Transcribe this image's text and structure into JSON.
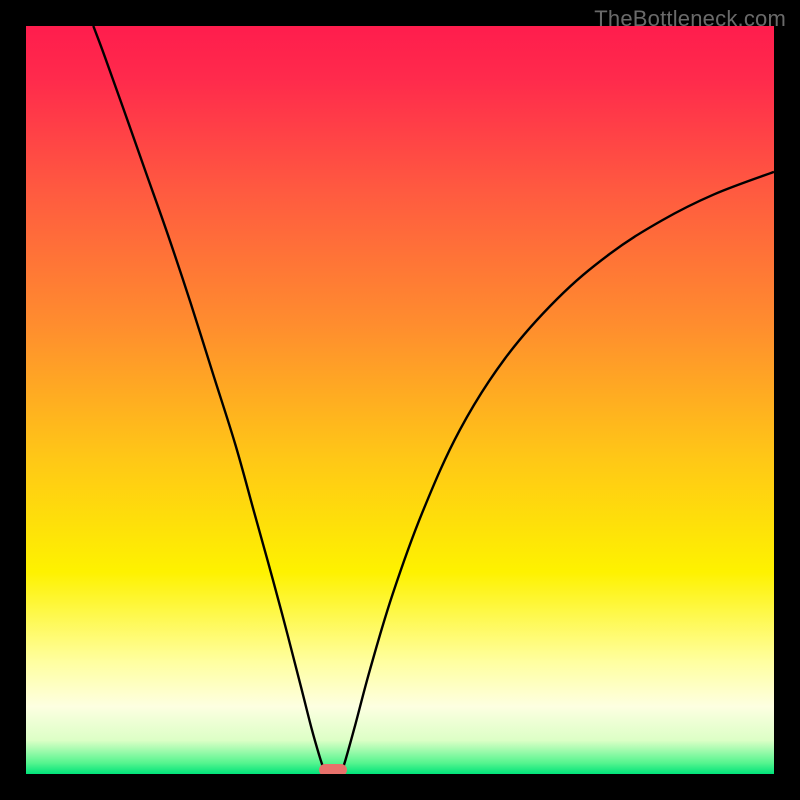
{
  "watermark": "TheBottleneck.com",
  "chart_data": {
    "type": "line",
    "title": "",
    "xlabel": "",
    "ylabel": "",
    "xlim": [
      0,
      100
    ],
    "ylim": [
      0,
      100
    ],
    "grid": false,
    "gradient_stops": [
      {
        "pos": 0.0,
        "color": "#ff1d4d"
      },
      {
        "pos": 0.07,
        "color": "#ff2a4c"
      },
      {
        "pos": 0.22,
        "color": "#ff5a40"
      },
      {
        "pos": 0.4,
        "color": "#ff8d2e"
      },
      {
        "pos": 0.58,
        "color": "#ffc816"
      },
      {
        "pos": 0.73,
        "color": "#fef200"
      },
      {
        "pos": 0.85,
        "color": "#ffffa0"
      },
      {
        "pos": 0.91,
        "color": "#fdffe1"
      },
      {
        "pos": 0.955,
        "color": "#dcffc6"
      },
      {
        "pos": 0.985,
        "color": "#57f58f"
      },
      {
        "pos": 1.0,
        "color": "#00e37a"
      }
    ],
    "series": [
      {
        "name": "left-curve",
        "color": "#000000",
        "points": [
          {
            "x": 9.0,
            "y": 100.0
          },
          {
            "x": 10.5,
            "y": 96.0
          },
          {
            "x": 13.0,
            "y": 89.0
          },
          {
            "x": 16.0,
            "y": 80.5
          },
          {
            "x": 19.0,
            "y": 72.0
          },
          {
            "x": 22.0,
            "y": 63.0
          },
          {
            "x": 25.0,
            "y": 53.5
          },
          {
            "x": 28.0,
            "y": 44.0
          },
          {
            "x": 30.5,
            "y": 35.0
          },
          {
            "x": 33.0,
            "y": 26.0
          },
          {
            "x": 35.0,
            "y": 18.5
          },
          {
            "x": 36.8,
            "y": 11.5
          },
          {
            "x": 38.2,
            "y": 6.0
          },
          {
            "x": 39.2,
            "y": 2.5
          },
          {
            "x": 39.8,
            "y": 0.7
          },
          {
            "x": 40.2,
            "y": 0.0
          }
        ]
      },
      {
        "name": "right-curve",
        "color": "#000000",
        "points": [
          {
            "x": 42.0,
            "y": 0.0
          },
          {
            "x": 42.6,
            "y": 1.5
          },
          {
            "x": 44.0,
            "y": 6.5
          },
          {
            "x": 46.0,
            "y": 14.0
          },
          {
            "x": 49.0,
            "y": 24.0
          },
          {
            "x": 53.0,
            "y": 35.0
          },
          {
            "x": 58.0,
            "y": 46.0
          },
          {
            "x": 64.0,
            "y": 55.5
          },
          {
            "x": 71.0,
            "y": 63.5
          },
          {
            "x": 78.0,
            "y": 69.5
          },
          {
            "x": 85.0,
            "y": 74.0
          },
          {
            "x": 92.0,
            "y": 77.5
          },
          {
            "x": 100.0,
            "y": 80.5
          }
        ]
      }
    ],
    "marker": {
      "x": 41.0,
      "y": 0.0,
      "color": "#e8716b"
    }
  }
}
